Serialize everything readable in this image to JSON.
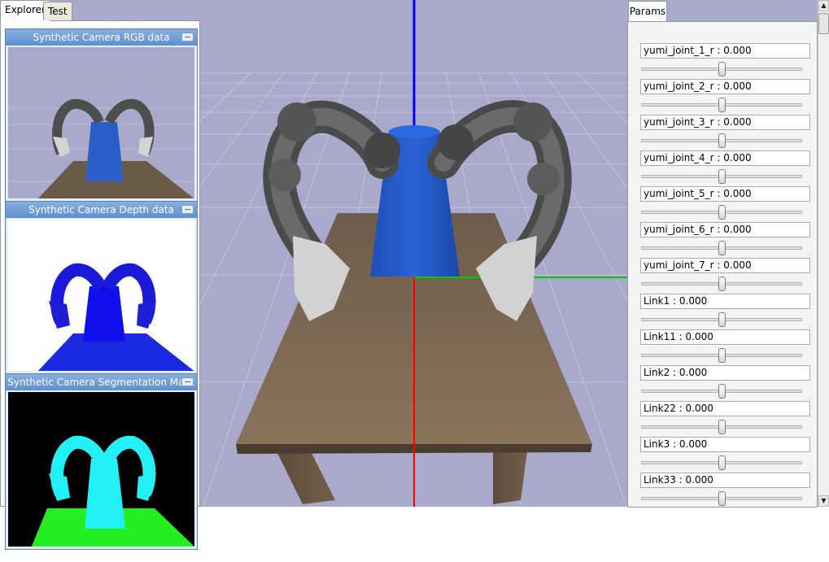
{
  "explorer_tabs": [
    {
      "label": "Explorer",
      "active": true
    },
    {
      "label": "Test",
      "active": false
    }
  ],
  "camera_windows": {
    "rgb": {
      "title": "Synthetic Camera RGB data"
    },
    "depth": {
      "title": "Synthetic Camera Depth data"
    },
    "segmentation": {
      "title": "Synthetic Camera Segmentation Mask"
    }
  },
  "params_tab": {
    "label": "Params"
  },
  "params": [
    {
      "label": "yumi_joint_1_r : 0.000",
      "slider_level": 0.5
    },
    {
      "label": "yumi_joint_2_r : 0.000",
      "slider_level": 0.5
    },
    {
      "label": "yumi_joint_3_r : 0.000",
      "slider_level": 0.5
    },
    {
      "label": "yumi_joint_4_r : 0.000",
      "slider_level": 0.5
    },
    {
      "label": "yumi_joint_5_r : 0.000",
      "slider_level": 0.5
    },
    {
      "label": "yumi_joint_6_r : 0.000",
      "slider_level": 0.5
    },
    {
      "label": "yumi_joint_7_r : 0.000",
      "slider_level": 0.5
    },
    {
      "label": "Link1 : 0.000",
      "slider_level": 0.5
    },
    {
      "label": "Link11 : 0.000",
      "slider_level": 0.5
    },
    {
      "label": "Link2 : 0.000",
      "slider_level": 0.5
    },
    {
      "label": "Link22 : 0.000",
      "slider_level": 0.5
    },
    {
      "label": "Link3 : 0.000",
      "slider_level": 0.5
    },
    {
      "label": "Link33 : 0.000",
      "slider_level": 0.5
    }
  ],
  "colors": {
    "viewport_background": "#a9a9cc",
    "axis_x": "#ff0000",
    "axis_y": "#00cc00",
    "axis_z": "#0000ff",
    "depth_object": "#1010ee",
    "segmentation_robot": "#22f0f4",
    "segmentation_table": "#22ee22"
  },
  "icons": {
    "minimize": "minimize-icon",
    "scroll_up": "scroll-up-arrow-icon",
    "scroll_down": "scroll-down-arrow-icon"
  }
}
